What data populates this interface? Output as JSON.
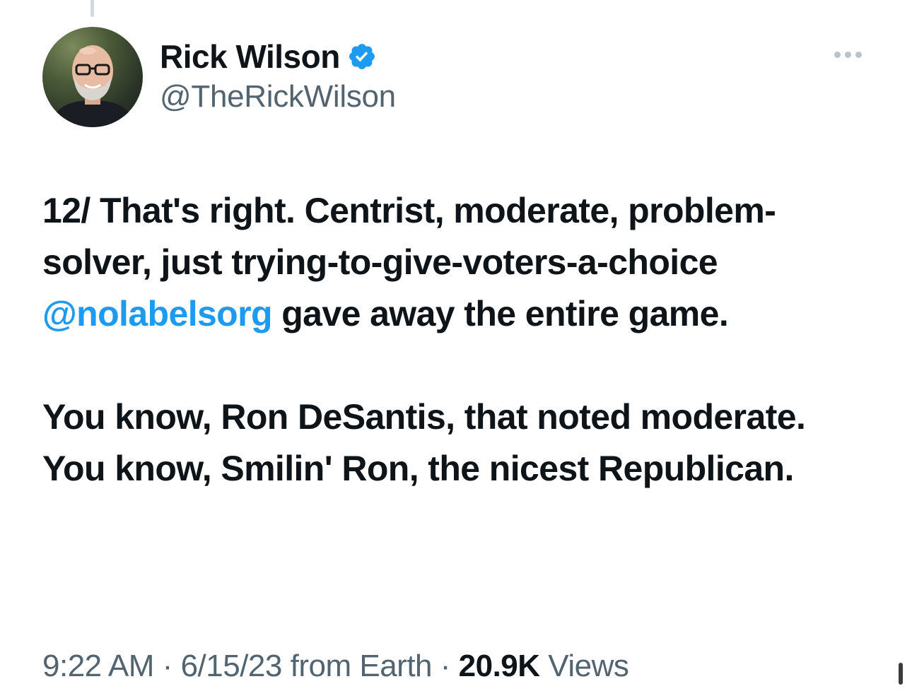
{
  "author": {
    "display_name": "Rick Wilson",
    "handle": "@TheRickWilson",
    "verified": true
  },
  "tweet": {
    "paragraph1_before": "12/ That's right. Centrist, moderate, problem-solver, just trying-to-give-voters-a-choice ",
    "mention": "@nolabelsorg",
    "paragraph1_after": " gave away the entire game.",
    "paragraph2": "You know, Ron DeSantis, that noted moderate. You know, Smilin' Ron, the nicest Republican."
  },
  "meta": {
    "time": "9:22 AM",
    "date": "6/15/23",
    "source_prefix": "from",
    "source": "Earth",
    "separator": "·",
    "views_count": "20.9K",
    "views_label": "Views"
  },
  "icons": {
    "verified": "verified-badge-icon",
    "more": "more-options-icon"
  },
  "colors": {
    "accent": "#1d9bf0",
    "text": "#0f1419",
    "secondary": "#536471"
  }
}
